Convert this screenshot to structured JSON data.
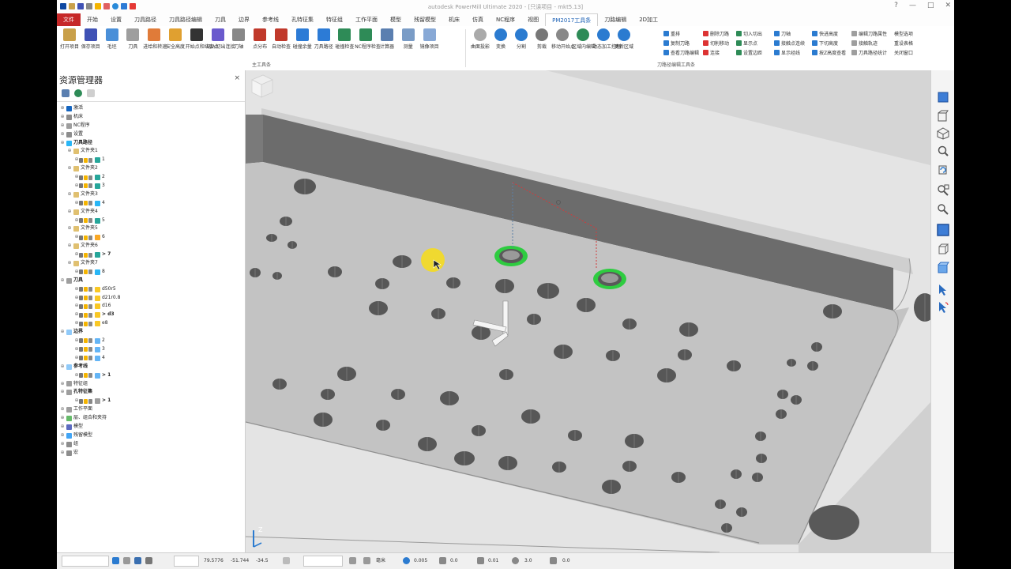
{
  "window": {
    "title": "autodesk PowerMill Ultimate 2020  -  [只读项目 - mkt5.13]",
    "controls": [
      "?",
      "—",
      "□",
      "✕"
    ]
  },
  "menu_tabs": [
    "文件",
    "开始",
    "设置",
    "刀具路径",
    "刀具路径编辑",
    "刀具",
    "边界",
    "参考线",
    "孔特征集",
    "特征组",
    "工作平面",
    "模型",
    "残留模型",
    "机床",
    "仿真",
    "NC程序",
    "视图",
    "PM2017工具条",
    "刀路编辑",
    "2D加工"
  ],
  "active_tab": "PM2017工具条",
  "ribbon": {
    "main_group_label": "主工具条",
    "edit_group_label": "刀路径编辑工具条",
    "main_buttons": [
      "打开项目",
      "保存项目",
      "毛坯",
      "刀具",
      "进给和转速",
      "安全高度",
      "开始点和结束点",
      "切入切出连接",
      "刀轴",
      "点分布",
      "自动检查",
      "碰撞余量",
      "刀具路径",
      "碰撞检查",
      "NC程序检查",
      "计算器",
      "测量",
      "镜像项目"
    ],
    "edit_buttons": [
      "曲面投影",
      "变换",
      "分割",
      "剪裁",
      "移动开始点",
      "区域内编辑",
      "动态加工控制",
      "更新区域"
    ],
    "small_col1": [
      "重排",
      "复制刀路",
      "查看刀路编辑"
    ],
    "small_col2": [
      "删除刀路",
      "切削移动",
      "连接"
    ],
    "small_col3": [
      "切入切出",
      "显示点",
      "设置边距"
    ],
    "small_col4": [
      "刀轴",
      "接触点连续",
      "显示经线"
    ],
    "small_col5": [
      "快进高度",
      "下切高度",
      "按Z高度查看"
    ],
    "small_col6": [
      "编辑刀路属性",
      "接触轨迹",
      "刀具路径统计"
    ],
    "small_col7": [
      "模型选项",
      "重设表格",
      "关闭窗口"
    ]
  },
  "explorer": {
    "title": "资源管理器",
    "close": "×",
    "tree": [
      {
        "depth": 0,
        "label": "激活",
        "icon": "#1565c0",
        "bold": false
      },
      {
        "depth": 0,
        "label": "机床",
        "icon": "#8d8d8d",
        "bold": false
      },
      {
        "depth": 0,
        "label": "NC程序",
        "icon": "#9e9e9e",
        "bold": false
      },
      {
        "depth": 0,
        "label": "设置",
        "icon": "#8d8d8d",
        "bold": false
      },
      {
        "depth": 0,
        "label": "刀具路径",
        "icon": "#29b6f6",
        "bold": true
      },
      {
        "depth": 1,
        "label": "文件夹1",
        "icon": "#e0c070",
        "bold": false
      },
      {
        "depth": 2,
        "label": "1",
        "icon": "#26a69a",
        "bold": false
      },
      {
        "depth": 1,
        "label": "文件夹2",
        "icon": "#e0c070",
        "bold": false
      },
      {
        "depth": 2,
        "label": "2",
        "icon": "#26a69a",
        "bold": false
      },
      {
        "depth": 2,
        "label": "3",
        "icon": "#26a69a",
        "bold": false
      },
      {
        "depth": 1,
        "label": "文件夹3",
        "icon": "#e0c070",
        "bold": false
      },
      {
        "depth": 2,
        "label": "4",
        "icon": "#29b6f6",
        "bold": false
      },
      {
        "depth": 1,
        "label": "文件夹4",
        "icon": "#e0c070",
        "bold": false
      },
      {
        "depth": 2,
        "label": "5",
        "icon": "#26a69a",
        "bold": false
      },
      {
        "depth": 1,
        "label": "文件夹5",
        "icon": "#e0c070",
        "bold": false
      },
      {
        "depth": 2,
        "label": "6",
        "icon": "#f9a825",
        "bold": false
      },
      {
        "depth": 1,
        "label": "文件夹6",
        "icon": "#e0c070",
        "bold": false
      },
      {
        "depth": 2,
        "label": "> 7",
        "icon": "#26a69a",
        "bold": true
      },
      {
        "depth": 1,
        "label": "文件夹7",
        "icon": "#e0c070",
        "bold": false
      },
      {
        "depth": 2,
        "label": "8",
        "icon": "#29b6f6",
        "bold": false
      },
      {
        "depth": 0,
        "label": "刀具",
        "icon": "#9e9e9e",
        "bold": true
      },
      {
        "depth": 2,
        "label": "d50r5",
        "icon": "#f9c825",
        "bold": false
      },
      {
        "depth": 2,
        "label": "d21r0.8",
        "icon": "#f9c825",
        "bold": false
      },
      {
        "depth": 2,
        "label": "d16",
        "icon": "#f9c825",
        "bold": false
      },
      {
        "depth": 2,
        "label": "> d3",
        "icon": "#f9c825",
        "bold": true
      },
      {
        "depth": 2,
        "label": "e8",
        "icon": "#f9c825",
        "bold": false
      },
      {
        "depth": 0,
        "label": "边界",
        "icon": "#90caf9",
        "bold": true
      },
      {
        "depth": 2,
        "label": "2",
        "icon": "#64b5f6",
        "bold": false
      },
      {
        "depth": 2,
        "label": "3",
        "icon": "#64b5f6",
        "bold": false
      },
      {
        "depth": 2,
        "label": "4",
        "icon": "#64b5f6",
        "bold": false
      },
      {
        "depth": 0,
        "label": "参考线",
        "icon": "#90caf9",
        "bold": true
      },
      {
        "depth": 2,
        "label": "> 1",
        "icon": "#64b5f6",
        "bold": true
      },
      {
        "depth": 0,
        "label": "特征组",
        "icon": "#9e9e9e",
        "bold": false
      },
      {
        "depth": 0,
        "label": "孔特征集",
        "icon": "#9e9e9e",
        "bold": true
      },
      {
        "depth": 2,
        "label": "> 1",
        "icon": "#9e9e9e",
        "bold": true
      },
      {
        "depth": 0,
        "label": "工作平面",
        "icon": "#9e9e9e",
        "bold": false
      },
      {
        "depth": 0,
        "label": "层、组合和夹持",
        "icon": "#66bb6a",
        "bold": false
      },
      {
        "depth": 0,
        "label": "模型",
        "icon": "#5c6bc0",
        "bold": false
      },
      {
        "depth": 0,
        "label": "残留模型",
        "icon": "#42a5f5",
        "bold": false
      },
      {
        "depth": 0,
        "label": "组",
        "icon": "#8d8d8d",
        "bold": false
      },
      {
        "depth": 0,
        "label": "宏",
        "icon": "#8d8d8d",
        "bold": false
      }
    ]
  },
  "viewport": {
    "triad_label": "Z",
    "highlight_color": "#2ecc40"
  },
  "statusbar": {
    "x": "79.5776",
    "y": "-51.744",
    "z": "-34.5",
    "unit": "毫米",
    "tolerance": "0.005",
    "stock": "0.0",
    "rapid": "0.01",
    "diameter": "3.0",
    "angle": "0.0"
  }
}
